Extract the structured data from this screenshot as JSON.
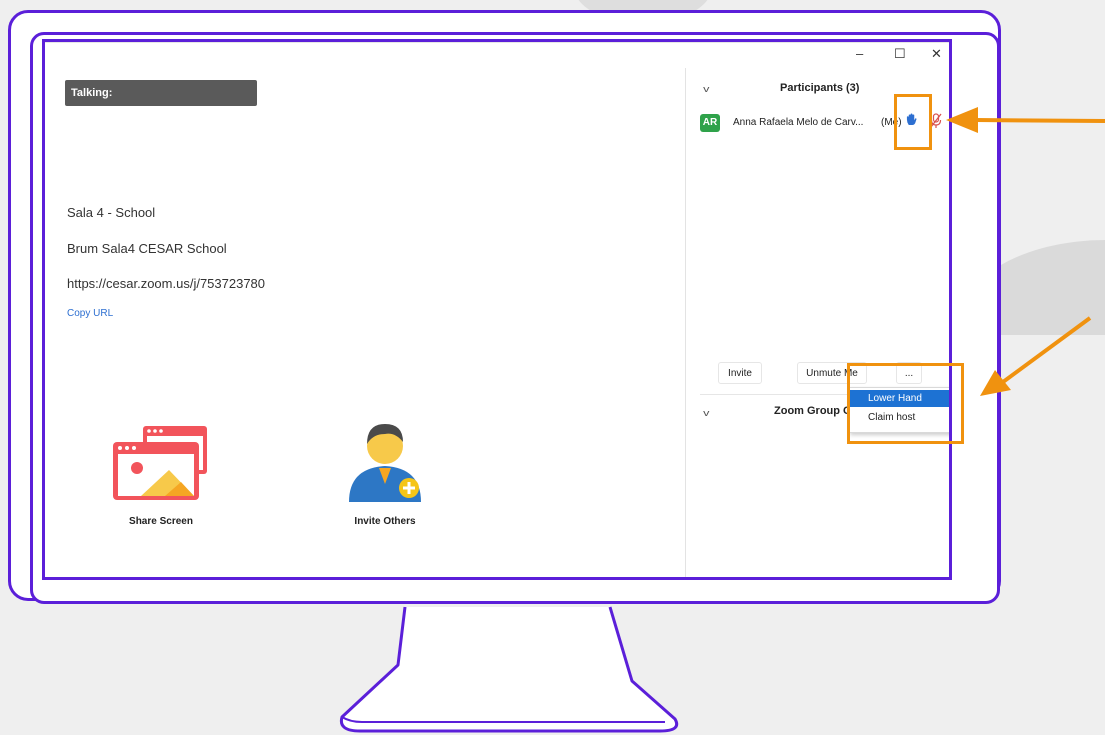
{
  "meeting": {
    "talking_label": "Talking:",
    "room_name": "Sala 4 - School",
    "meeting_topic": "Brum Sala4 CESAR School",
    "meeting_url": "https://cesar.zoom.us/j/753723780",
    "copy_url_label": "Copy URL"
  },
  "actions": {
    "share_screen_label": "Share Screen",
    "invite_others_label": "Invite Others"
  },
  "window_controls": {
    "minimize": "–",
    "maximize": "☐",
    "close": "✕"
  },
  "participants_panel": {
    "title": "Participants (3)",
    "participant": {
      "initials": "AR",
      "name": "Anna Rafaela Melo de Carv...",
      "tag": "(Me)"
    },
    "buttons": {
      "invite": "Invite",
      "unmute_me": "Unmute Me",
      "more": "..."
    },
    "context_menu": [
      "Lower Hand",
      "Claim host"
    ],
    "zoom_group_chat_title": "Zoom Group Chat"
  },
  "colors": {
    "frame": "#5b1fd9",
    "highlight": "#f0920f",
    "menu_selected": "#1d72d3",
    "avatar": "#2fa24a"
  }
}
